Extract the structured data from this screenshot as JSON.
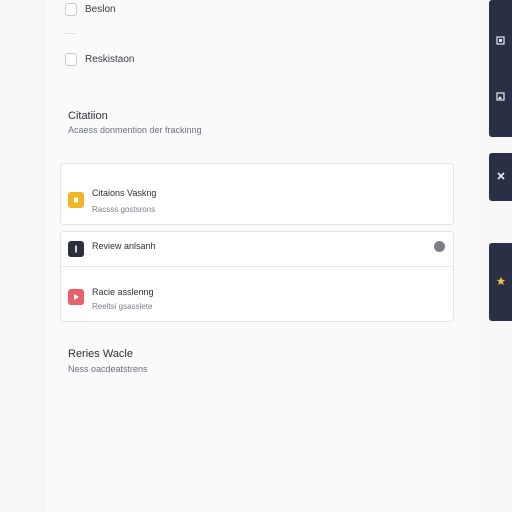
{
  "checklist": {
    "items": [
      {
        "label": "Beslon"
      },
      {
        "label": "Reskistaon"
      }
    ]
  },
  "section1": {
    "title": "Citatiion",
    "subtitle": "Acaess donmention der frackinng"
  },
  "card1": {
    "row1": {
      "title": "Citaions Vaskng",
      "subtitle": "Racsss gostsrons"
    }
  },
  "card2": {
    "row1": {
      "title": "Review anlsanh"
    },
    "row2": {
      "title": "Racie asslenng",
      "subtitle": "Reeltsi gsasslete"
    }
  },
  "section2": {
    "title": "Reries Wacle",
    "subtitle": "Ness oacdeatstrens"
  },
  "colors": {
    "yellow": "#f0b62b",
    "dark": "#2b2f3a",
    "red": "#e8606a",
    "rail": "#2b2f45"
  },
  "icons": {
    "rail_top_1": "document-icon",
    "rail_top_2": "image-icon",
    "rail_mid": "puzzle-icon",
    "rail_bottom": "star-icon"
  }
}
